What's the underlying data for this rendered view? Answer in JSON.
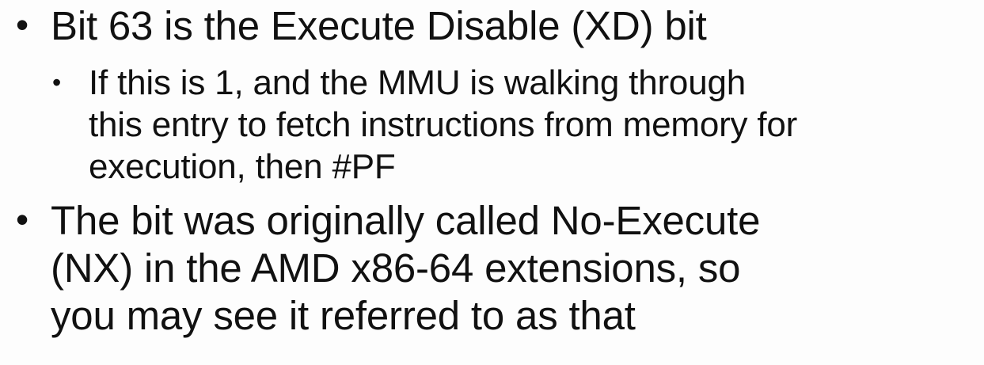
{
  "slide": {
    "bullet_char": "•",
    "sub_bullet_char": "•",
    "bullets": [
      {
        "lines": [
          "Bit 63 is the Execute Disable (XD) bit"
        ],
        "sub_bullets": [
          {
            "lines": [
              "If this is 1, and the MMU is walking through",
              "this entry to fetch instructions from memory for",
              "execution, then #PF"
            ]
          }
        ]
      },
      {
        "lines": [
          "The bit was originally called No-Execute",
          "(NX) in the AMD x86-64 extensions, so",
          "you may see it referred to as that"
        ]
      }
    ]
  },
  "colors": {
    "background": "#fdfdfd",
    "text": "#111111"
  }
}
